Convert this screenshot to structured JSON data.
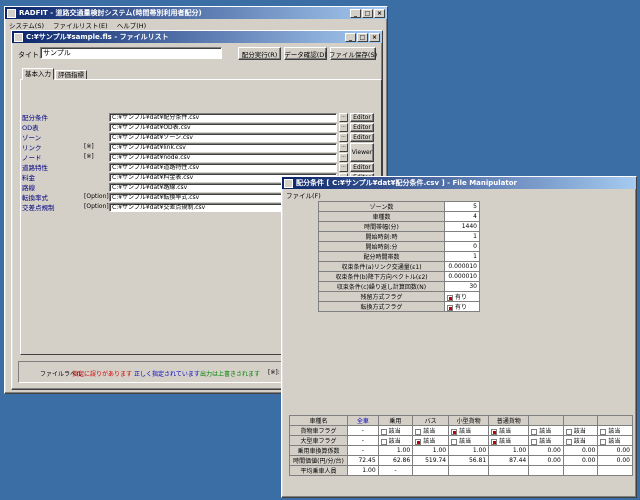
{
  "main": {
    "title": "RADFIT - 道路交通量検討システム(時間帯別利用者配分)",
    "menu": [
      "システム(S)",
      "ファイルリスト(E)",
      "ヘルプ(H)"
    ]
  },
  "filelist": {
    "title": "C:¥サンプル¥sample.fls - ファイルリスト",
    "title_label": "タイトル",
    "title_value": "サンプル",
    "buttons": {
      "run": "配分実行(R)",
      "check": "データ確認(D)",
      "save": "ファイル保存(S)"
    },
    "tabs": [
      "基本入力",
      "評価指標"
    ],
    "rows": [
      {
        "label": "配分条件",
        "opt": "",
        "path": "C:¥サンプル¥dat¥配分条件.csv",
        "action": "Editor"
      },
      {
        "label": "OD表",
        "opt": "",
        "path": "C:¥サンプル¥dat¥OD表.csv",
        "action": "Editor"
      },
      {
        "label": "ゾーン",
        "opt": "",
        "path": "C:¥サンプル¥dat¥ゾーン.csv",
        "action": "Editor"
      },
      {
        "label": "リンク",
        "opt": "[※]",
        "path": "C:¥サンプル¥dat¥link.csv",
        "action": "Viewer"
      },
      {
        "label": "ノード",
        "opt": "[※]",
        "path": "C:¥サンプル¥dat¥node.csv",
        "action": ""
      },
      {
        "label": "道路特性",
        "opt": "",
        "path": "C:¥サンプル¥dat¥道路特性.csv",
        "action": "Editor"
      },
      {
        "label": "料金",
        "opt": "",
        "path": "C:¥サンプル¥dat¥料金表.csv",
        "action": "Editor"
      },
      {
        "label": "路線",
        "opt": "",
        "path": "C:¥サンプル¥dat¥路線.csv",
        "action": "Editor"
      },
      {
        "label": "転換率式",
        "opt": "[Option]",
        "path": "C:¥サンプル¥dat¥転換率式.csv",
        "action": "Editor"
      },
      {
        "label": "交差点規制",
        "opt": "[Option]",
        "path": "C:¥サンプル¥dat¥交差点規制.csv",
        "action": "Editor"
      }
    ],
    "legend": {
      "head": "ファイルラベル:",
      "error": "指定に誤りがあります",
      "ok": "正しく指定されています",
      "overwrite": "出力は上書きされます",
      "mark": "[※]:"
    },
    "colors": {
      "error": "#d00000",
      "ok": "#0000c0",
      "overwrite": "#008000"
    }
  },
  "fm": {
    "title": "配分条件 [ C:¥サンプル¥dat¥配分条件.csv ] - File Manipulator",
    "menu": "ファイル(F)",
    "params": [
      {
        "label": "ゾーン数",
        "value": "5"
      },
      {
        "label": "車種数",
        "value": "4"
      },
      {
        "label": "時間帯幅(分)",
        "value": "1440"
      },
      {
        "label": "開始時刻:時",
        "value": "1"
      },
      {
        "label": "開始時刻:分",
        "value": "0"
      },
      {
        "label": "配分時間帯数",
        "value": "1"
      },
      {
        "label": "収束条件(a)リンク交通量(ε1)",
        "value": "0.000010"
      },
      {
        "label": "収束条件(b)降下方向ベクトル(ε2)",
        "value": "0.000010"
      },
      {
        "label": "収束条件(c)繰り返し計算回数(N)",
        "value": "30"
      },
      {
        "label": "残留方式フラグ",
        "value": "有り",
        "check": true
      },
      {
        "label": "転換方式フラグ",
        "value": "有り",
        "check": true
      }
    ],
    "vehicle_table": {
      "row_header": "車種名",
      "columns": [
        "全車",
        "乗用",
        "バス",
        "小型貨物",
        "普通貨物",
        "",
        "",
        ""
      ],
      "rows": [
        {
          "label": "貨物車フラグ",
          "cells": [
            "-",
            "該当",
            "該当",
            "該当",
            "該当",
            "該当",
            "該当",
            "該当"
          ],
          "checked": [
            false,
            false,
            false,
            true,
            true,
            false,
            false,
            false
          ]
        },
        {
          "label": "大型車フラグ",
          "cells": [
            "-",
            "該当",
            "該当",
            "該当",
            "該当",
            "該当",
            "該当",
            "該当"
          ],
          "checked": [
            false,
            false,
            true,
            false,
            true,
            false,
            false,
            false
          ]
        },
        {
          "label": "乗用車換算係数",
          "cells": [
            "-",
            "1.00",
            "1.00",
            "1.00",
            "1.00",
            "0.00",
            "0.00",
            "0.00"
          ]
        },
        {
          "label": "時間価値(円/分/台)",
          "cells": [
            "72.45",
            "62.86",
            "519.74",
            "56.81",
            "87.44",
            "0.00",
            "0.00",
            "0.00"
          ]
        },
        {
          "label": "平均乗車人員",
          "cells": [
            "1.00",
            "-",
            "",
            "",
            "",
            "",
            "",
            ""
          ]
        }
      ]
    }
  }
}
